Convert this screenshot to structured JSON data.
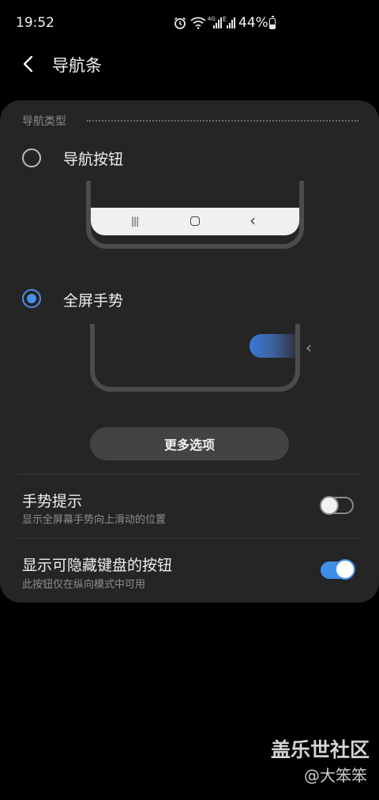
{
  "status_bar": {
    "time": "19:52",
    "battery_percent_text": "44%",
    "battery_level": 0.44,
    "icons": [
      "alarm-icon",
      "wifi-icon",
      "signal-4g-icon",
      "signal-e-icon",
      "battery-icon"
    ],
    "ico_alarm": "⏰",
    "ico_wifi": "",
    "ico_4g": "4G",
    "ico_e": "E"
  },
  "header": {
    "title": "导航条"
  },
  "nav_type": {
    "section_label": "导航类型",
    "option_buttons": {
      "label": "导航按钮",
      "selected": false
    },
    "option_gestures": {
      "label": "全屏手势",
      "selected": true
    },
    "preview_nav_icons": {
      "recents": "|||",
      "back": "‹"
    },
    "gesture_chevron": "‹",
    "more_options_label": "更多选项"
  },
  "settings": [
    {
      "title": "手势提示",
      "subtitle": "显示全屏幕手势向上滑动的位置",
      "enabled": false
    },
    {
      "title": "显示可隐藏键盘的按钮",
      "subtitle": "此按钮仅在纵向模式中可用",
      "enabled": true
    }
  ],
  "watermark": {
    "line1": "盖乐世社区",
    "line2": "@大笨笨"
  },
  "colors": {
    "accent": "#3f8ee8",
    "card_bg": "#252525",
    "background": "#000000"
  }
}
